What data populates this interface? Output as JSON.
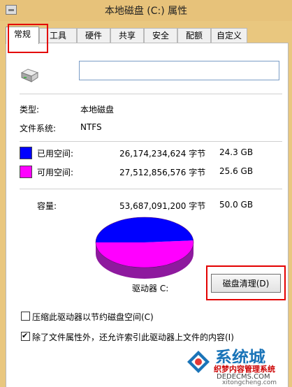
{
  "window": {
    "title": "本地磁盘 (C:) 属性"
  },
  "tabs": [
    {
      "label": "常规"
    },
    {
      "label": "工具"
    },
    {
      "label": "硬件"
    },
    {
      "label": "共享"
    },
    {
      "label": "安全"
    },
    {
      "label": "配额"
    },
    {
      "label": "自定义"
    }
  ],
  "general": {
    "name_value": "",
    "type_label": "类型:",
    "type_value": "本地磁盘",
    "fs_label": "文件系统:",
    "fs_value": "NTFS",
    "used": {
      "label": "已用空间:",
      "bytes": "26,174,234,624 字节",
      "size": "24.3 GB",
      "color": "#0000ff"
    },
    "free": {
      "label": "可用空间:",
      "bytes": "27,512,856,576 字节",
      "size": "25.6 GB",
      "color": "#ff00ff"
    },
    "capacity": {
      "label": "容量:",
      "bytes": "53,687,091,200 字节",
      "size": "50.0 GB"
    },
    "drive_label": "驱动器 C:",
    "cleanup_button": "磁盘清理(D)",
    "compress_label": "压缩此驱动器以节约磁盘空间(C)",
    "compress_checked": false,
    "index_label": "除了文件属性外，还允许索引此驱动器上文件的内容(I)",
    "index_checked": true
  },
  "pie_chart": {
    "used_fraction": 0.4875,
    "free_fraction": 0.5125,
    "used_color": "#0000ff",
    "free_color": "#ff00ff"
  },
  "watermark": {
    "brand": "系统城",
    "sub": "织梦内容管理系统",
    "url": "DEDECMS.COM",
    "url2": "xitongcheng.com"
  }
}
